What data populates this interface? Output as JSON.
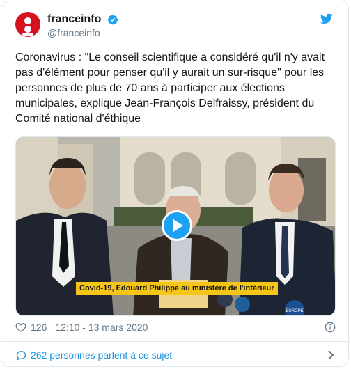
{
  "tweet": {
    "author": {
      "display_name": "franceinfo",
      "handle": "@franceinfo",
      "verified": true,
      "avatar_icon": "franceinfo-logo-icon",
      "avatar_color": "#d7111d"
    },
    "text": "Coronavirus : \"Le conseil scientifique a considéré qu'il n'y avait pas d'élément pour penser qu'il y aurait un sur-risque\" pour les personnes de plus de 70 ans à participer aux élections municipales, explique Jean-François Delfraissy, président du Comité national d'éthique",
    "media": {
      "type": "video",
      "caption": "Covid-19, Edouard Philippe au ministère de l'intérieur",
      "play_icon": "play-icon",
      "mic_label": "EUROPE"
    },
    "likes": "126",
    "timestamp": "12:10 - 13 mars 2020",
    "footer_text": "262 personnes parlent à ce sujet"
  },
  "colors": {
    "accent": "#1da1f2",
    "link": "#1b95e0",
    "muted": "#657786",
    "caption_bg": "#f5c518"
  }
}
